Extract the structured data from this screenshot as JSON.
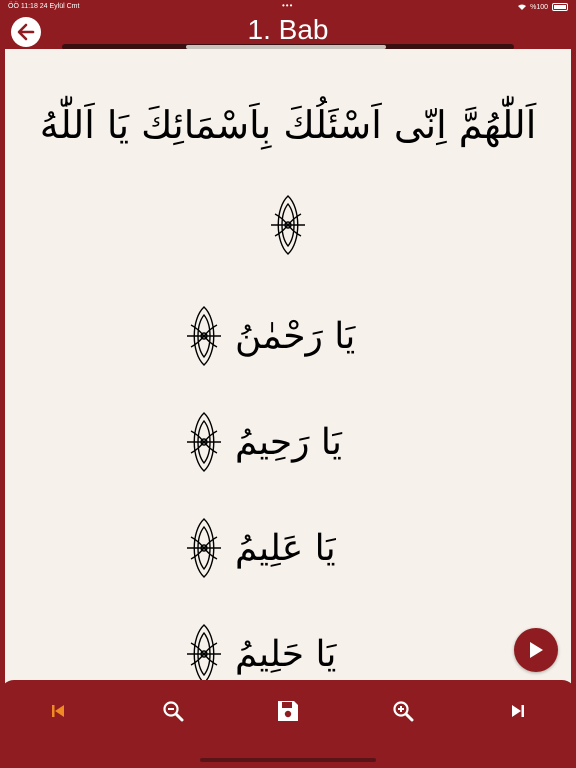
{
  "status_bar": {
    "time_date": "ÖÖ 11:18  24 Eylül Cmt",
    "battery": "%100"
  },
  "header": {
    "title": "1. Bab"
  },
  "content": {
    "invocation": "اَللّٰهُمَّ اِنّى اَسْئَلُكَ بِاَسْمَائِكَ  يَا اَللّٰهُ",
    "names": [
      "يَا رَحْمٰنُ",
      "يَا رَحِيمُ",
      "يَا عَلِيمُ",
      "يَا حَلِيمُ"
    ]
  },
  "toolbar": {
    "icons": [
      "skip-previous-icon",
      "zoom-out-icon",
      "save-icon",
      "zoom-in-icon",
      "skip-next-icon"
    ]
  },
  "colors": {
    "primary": "#8e1c20",
    "page": "#f6f1ea",
    "accent": "#f08a24"
  }
}
